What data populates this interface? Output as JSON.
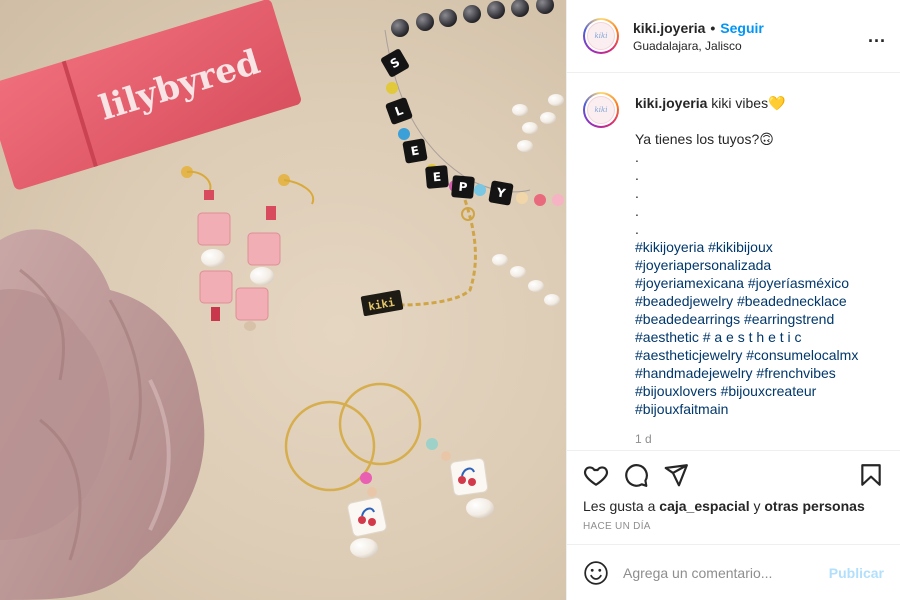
{
  "photo": {
    "box_brand": "lilybyred",
    "tag_text": "kiki",
    "bracelet_letters": [
      "S",
      "L",
      "E",
      "E",
      "P",
      "Y"
    ]
  },
  "header": {
    "username": "kiki.joyeria",
    "separator": "•",
    "follow_label": "Seguir",
    "location": "Guadalajara, Jalisco",
    "more_icon": "ellipsis-icon",
    "more_label": "..."
  },
  "avatar": {
    "text": "kiki"
  },
  "caption": {
    "username": "kiki.joyeria",
    "text": "kiki vibes💛",
    "question": "Ya tienes los tuyos?🙃",
    "dots": [
      ".",
      ".",
      ".",
      ".",
      "."
    ],
    "hashtags": [
      "#kikijoyeria #kikibijoux",
      "#joyeriapersonalizada",
      "#joyeriamexicana #joyeríasméxico",
      "#beadedjewelry #beadednecklace",
      "#beadedearrings #earringstrend",
      "#aesthetic # a e s t h e t i c",
      "#aestheticjewelry #consumelocalmx",
      "#handmadejewelry #frenchvibes",
      "#bijouxlovers #bijouxcreateur",
      "#bijouxfaitmain"
    ],
    "age": "1 d"
  },
  "actions": {
    "like_icon": "heart-icon",
    "comment_icon": "comment-icon",
    "share_icon": "paper-plane-icon",
    "save_icon": "bookmark-icon",
    "likes_prefix": "Les gusta a",
    "likes_user": "caja_espacial",
    "likes_conj": "y",
    "likes_others": "otras personas",
    "timestamp": "HACE UN DÍA"
  },
  "comment": {
    "emoji_icon": "smiley-icon",
    "placeholder": "Agrega un comentario...",
    "publish_label": "Publicar"
  },
  "colors": {
    "accent": "#0095f6",
    "hashtag": "#00376b",
    "muted": "#8e8e8e",
    "publish_disabled": "#b2dffc"
  }
}
